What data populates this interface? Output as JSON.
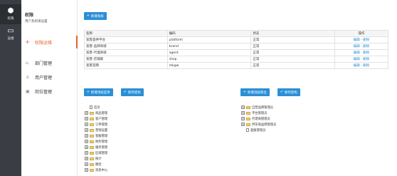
{
  "rail": [
    {
      "icon": "cube-icon",
      "glyph": "⬢",
      "label": "权限"
    },
    {
      "icon": "monitor-icon",
      "glyph": "▭",
      "label": "运维"
    }
  ],
  "sidebar": {
    "title": "权限",
    "subtitle": "用户及权限设置",
    "items": [
      {
        "label": "权限运维",
        "glyph": "✣"
      },
      {
        "label": "部门管理",
        "glyph": "⌂"
      },
      {
        "label": "用户管理",
        "glyph": "♙"
      },
      {
        "label": "岗位管理",
        "glyph": "▣"
      }
    ]
  },
  "toolbar": {
    "add_system": "新增系统",
    "add_menu": "新增顶层菜单",
    "save_structure_left": "保存结构",
    "add_position": "新增顶层岗位",
    "save_structure_right": "保存结构"
  },
  "table": {
    "headers": [
      "名称",
      "编码",
      "状态",
      "操作"
    ],
    "rows": [
      {
        "name": "宽客直供平台",
        "code": "platform",
        "status": "正常",
        "edit": "编辑",
        "delete": "删除"
      },
      {
        "name": "宽客-品牌商城",
        "code": "brand",
        "status": "正常",
        "edit": "编辑",
        "delete": "删除"
      },
      {
        "name": "宽客-代理商城",
        "code": "agent",
        "status": "正常",
        "edit": "编辑",
        "delete": "删除"
      },
      {
        "name": "宽客-店铺版",
        "code": "shop",
        "status": "正常",
        "edit": "编辑",
        "delete": "删除"
      },
      {
        "name": "宽客官网",
        "code": "mkgw",
        "status": "正常",
        "edit": "编辑",
        "delete": "删除"
      }
    ]
  },
  "menu_tree": [
    {
      "label": "首页",
      "expander": "",
      "kind": "doc"
    },
    {
      "label": "商品管理",
      "expander": "+",
      "kind": "folder"
    },
    {
      "label": "客户管理",
      "expander": "+",
      "kind": "folder"
    },
    {
      "label": "订单管理",
      "expander": "+",
      "kind": "folder"
    },
    {
      "label": "营销设置",
      "expander": "+",
      "kind": "folder"
    },
    {
      "label": "客服管理",
      "expander": "+",
      "kind": "folder"
    },
    {
      "label": "财务管理",
      "expander": "+",
      "kind": "folder"
    },
    {
      "label": "服务管理",
      "expander": "+",
      "kind": "folder"
    },
    {
      "label": "区域管理",
      "expander": "+",
      "kind": "folder"
    },
    {
      "label": "统计",
      "expander": "+",
      "kind": "folder"
    },
    {
      "label": "稿型",
      "expander": "+",
      "kind": "folder"
    },
    {
      "label": "消息中心",
      "expander": "+",
      "kind": "folder"
    }
  ],
  "position_tree": [
    {
      "label": "自营品牌管理员",
      "expander": "+",
      "kind": "folder"
    },
    {
      "label": "平台管理员",
      "expander": "+",
      "kind": "folder"
    },
    {
      "label": "代理商管理员",
      "expander": "+",
      "kind": "folder"
    },
    {
      "label": "供货商品牌管理员",
      "expander": "+",
      "kind": "folder"
    },
    {
      "label": "超级管理员",
      "expander": "",
      "kind": "doc"
    }
  ]
}
